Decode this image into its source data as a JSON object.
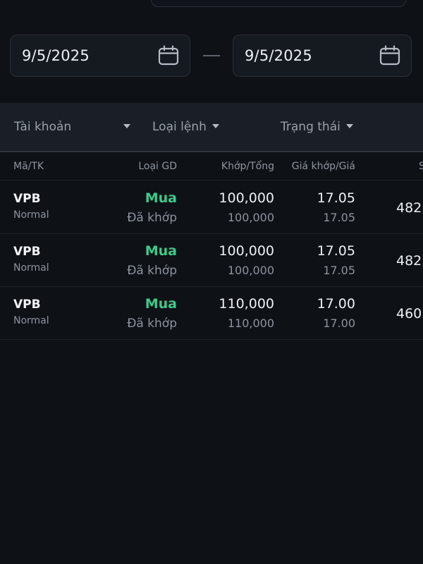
{
  "filters": {
    "date_from": "9/5/2025",
    "date_to": "9/5/2025",
    "account_label": "Tài khoản",
    "order_type_label": "Loại lệnh",
    "status_label": "Trạng thái"
  },
  "table": {
    "headers": {
      "symbol": "Mã/TK",
      "trade_type": "Loại GD",
      "matched_total": "Khớp/Tổng",
      "price": "Giá khớp/Giá",
      "extra": "S"
    },
    "rows": [
      {
        "symbol": "VPB",
        "account": "Normal",
        "side": "Mua",
        "status": "Đã khớp",
        "matched": "100,000",
        "total": "100,000",
        "match_price": "17.05",
        "order_price": "17.05",
        "extra": "482"
      },
      {
        "symbol": "VPB",
        "account": "Normal",
        "side": "Mua",
        "status": "Đã khớp",
        "matched": "100,000",
        "total": "100,000",
        "match_price": "17.05",
        "order_price": "17.05",
        "extra": "482"
      },
      {
        "symbol": "VPB",
        "account": "Normal",
        "side": "Mua",
        "status": "Đã khớp",
        "matched": "110,000",
        "total": "110,000",
        "match_price": "17.00",
        "order_price": "17.00",
        "extra": "460"
      }
    ]
  },
  "colors": {
    "background": "#0e1116",
    "buy": "#3fc98a",
    "muted_text": "#8d949e"
  },
  "icons": {
    "date_picker": "calendar-icon",
    "filter_dropdown": "caret-down-icon"
  }
}
